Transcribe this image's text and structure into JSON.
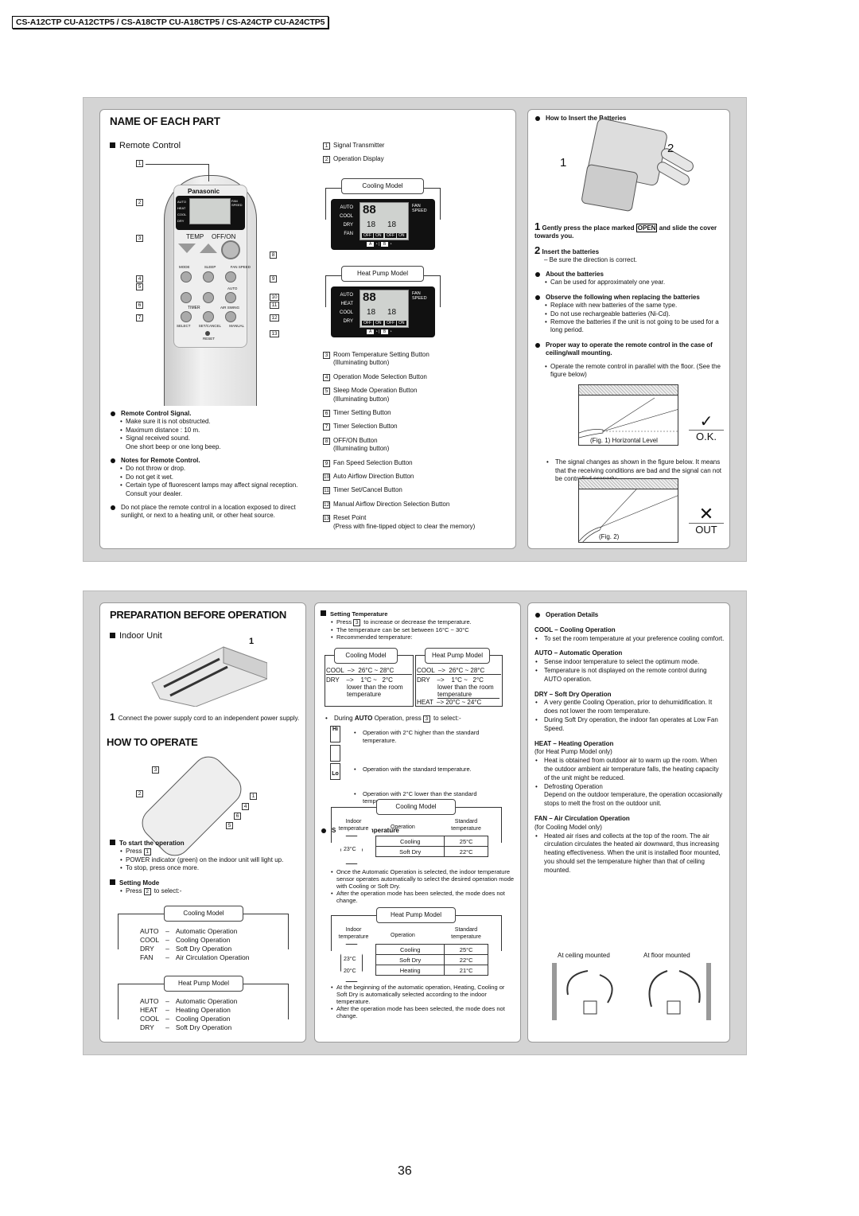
{
  "header": {
    "models": "CS-A12CTP CU-A12CTP5 / CS-A18CTP CU-A18CTP5 / CS-A24CTP CU-A24CTP5"
  },
  "name_of_each_part": {
    "title": "NAME OF EACH PART",
    "remote_heading": "Remote Control",
    "remote": {
      "brand": "Panasonic",
      "modes": [
        "AUTO",
        "HEAT",
        "COOL",
        "DRY"
      ],
      "fan_speed": "FAN SPEED",
      "temp": "TEMP",
      "offon": "OFF/ON",
      "mode": "MODE",
      "sleep": "SLEEP",
      "fanspeed": "FAN SPEED",
      "auto": "AUTO",
      "timer": "TIMER",
      "air_swing": "AIR SWING",
      "select": "SELECT",
      "setcancel": "SET/CANCEL",
      "manual": "MANUAL",
      "reset": "RESET",
      "callouts": [
        "1",
        "2",
        "3",
        "4",
        "5",
        "6",
        "7",
        "8",
        "9",
        "10",
        "11",
        "12",
        "13"
      ]
    },
    "parts": [
      {
        "n": "1",
        "label": "Signal Transmitter"
      },
      {
        "n": "2",
        "label": "Operation Display"
      },
      {
        "n": "3",
        "label": "Room Temperature Setting Button",
        "sub": "(Illuminating button)"
      },
      {
        "n": "4",
        "label": "Operation Mode Selection Button"
      },
      {
        "n": "5",
        "label": "Sleep Mode Operation Button",
        "sub": "(Illuminating button)"
      },
      {
        "n": "6",
        "label": "Timer Setting Button"
      },
      {
        "n": "7",
        "label": "Timer Selection Button"
      },
      {
        "n": "8",
        "label": "OFF/ON Button",
        "sub": "(Illuminating button)"
      },
      {
        "n": "9",
        "label": "Fan Speed Selection Button"
      },
      {
        "n": "10",
        "label": "Auto Airflow Direction Button"
      },
      {
        "n": "11",
        "label": "Timer Set/Cancel Button"
      },
      {
        "n": "12",
        "label": "Manual Airflow Direction Selection Button"
      },
      {
        "n": "13",
        "label": "Reset Point",
        "sub": "(Press with fine-tipped object to clear the memory)"
      }
    ],
    "displays": [
      {
        "title": "Cooling Model",
        "modes": [
          "AUTO",
          "COOL",
          "DRY",
          "FAN"
        ],
        "digits": "88",
        "timer": "18",
        "fan": "FAN SPEED",
        "off": "OFF",
        "on": "ON",
        "a": "A",
        "b": "B"
      },
      {
        "title": "Heat Pump Model",
        "modes": [
          "AUTO",
          "HEAT",
          "COOL",
          "DRY"
        ],
        "digits": "88",
        "timer": "18",
        "fan": "FAN SPEED",
        "off": "OFF",
        "on": "ON",
        "a": "A",
        "b": "B"
      }
    ],
    "signal": {
      "title": "Remote Control Signal.",
      "items": [
        "Make sure it is not obstructed.",
        "Maximum distance : 10 m.",
        "Signal received sound."
      ],
      "extra": "One short beep or one long beep."
    },
    "notes": {
      "title": "Notes for Remote Control.",
      "items": [
        "Do not throw or drop.",
        "Do not get it wet.",
        "Certain type of fluorescent lamps may affect signal reception. Consult your dealer."
      ]
    },
    "placement": "Do not place the remote control in a location exposed to direct sunlight, or next to a heating unit, or other heat  source."
  },
  "batteries": {
    "title": "How  to Insert the Batteries",
    "fig_labels": [
      "1",
      "2"
    ],
    "step1_num": "1",
    "step1_a": "Gently press the place marked",
    "step1_open": "OPEN",
    "step1_b": "and slide the cover towards you.",
    "step2_num": "2",
    "step2": "Insert the batteries",
    "step2_sub": "– Be sure the direction is correct.",
    "about": {
      "title": "About the batteries",
      "items": [
        "Can be used for approximately one year."
      ]
    },
    "observe": {
      "title": "Observe the following when replacing the batteries",
      "items": [
        "Replace with new batteries of the same type.",
        "Do not use rechargeable batteries (Ni-Cd).",
        "Remove the batteries if the unit is not going to be used for a long period."
      ]
    },
    "proper": {
      "title": "Proper way to operate the remote control in the case of ceiling/wall mounting.",
      "items": [
        "Operate the remote control in parallel with the floor. (See the figure below)"
      ]
    },
    "fig1": "(Fig. 1) Horizontal Level",
    "ok": "O.K.",
    "signal_note": "The signal changes as shown in the figure below. It means that the receiving conditions are bad and the signal can not be controlled properly.",
    "fig2": "(Fig. 2)",
    "out": "OUT"
  },
  "preparation": {
    "title": "PREPARATION BEFORE OPERATION",
    "indoor": "Indoor Unit",
    "callout": "1",
    "step_num": "1",
    "step": "Connect the power supply cord to an independent power supply."
  },
  "how_to_operate": {
    "title": "HOW TO OPERATE",
    "callouts": [
      "3",
      "2",
      "1",
      "4",
      "6",
      "5"
    ],
    "start": {
      "title": "To start the operation",
      "press": "Press",
      "key": "1",
      "items": [
        "POWER indicator (green) on the indoor unit will light up.",
        "To stop, press once more."
      ]
    },
    "mode": {
      "title": "Setting Mode",
      "press": "Press",
      "key": "2",
      "to_select": "to select:-",
      "cooling": {
        "title": "Cooling Model",
        "rows": [
          [
            "AUTO",
            "–",
            "Automatic Operation"
          ],
          [
            "COOL",
            "–",
            "Cooling Operation"
          ],
          [
            "DRY",
            "–",
            "Soft Dry Operation"
          ],
          [
            "FAN",
            "–",
            "Air Circulation Operation"
          ]
        ]
      },
      "heatpump": {
        "title": "Heat Pump Model",
        "rows": [
          [
            "AUTO",
            "–",
            "Automatic Operation"
          ],
          [
            "HEAT",
            "–",
            "Heating Operation"
          ],
          [
            "COOL",
            "–",
            "Cooling Operation"
          ],
          [
            "DRY",
            "–",
            "Soft Dry Operation"
          ]
        ]
      }
    }
  },
  "setting_temp": {
    "title": "Setting Temperature",
    "b1a": "Press",
    "key": "3",
    "b1b": "to increase or decrease the temperature.",
    "b2": "The temperature can be set between 16°C ~ 30°C",
    "b3": "Recommended temperature:",
    "cooling": {
      "title": "Cooling Model",
      "cool": "COOL  –>  26°C ~ 28°C",
      "dry": "DRY    –>    1°C ~   2°C",
      "dry_note": "lower than the room temperature"
    },
    "heatpump": {
      "title": "Heat Pump Model",
      "cool": "COOL  –>  26°C ~ 28°C",
      "dry": "DRY    –>    1°C ~   2°C",
      "dry_note": "lower than the room temperature",
      "heat": "HEAT  –> 20°C ~ 24°C"
    },
    "auto_a": "During",
    "auto_b": "AUTO",
    "auto_c": "Operation, press",
    "auto_d": "to select:-",
    "icon_hi": "Hi",
    "icon_lo": "Lo",
    "options": [
      "Operation with 2°C higher than the standard temperature.",
      "Operation with the standard temperature.",
      "Operation with 2°C lower than the standard temperature."
    ]
  },
  "standard_temp": {
    "title": "Standard Temperature",
    "cooling": {
      "title": "Cooling Model",
      "indoor": "Indoor temperature",
      "operation": "Operation",
      "standard": "Standard temperature",
      "thresholds": [
        "23°C"
      ],
      "rows": [
        [
          "Cooling",
          "25°C"
        ],
        [
          "Soft Dry",
          "22°C"
        ]
      ]
    },
    "notes1": [
      "Once the Automatic Operation is selected, the indoor temperature sensor operates automatically to select the desired operation mode with Cooling or Soft Dry.",
      "After the operation mode has been selected, the mode does not change."
    ],
    "heatpump": {
      "title": "Heat Pump Model",
      "indoor": "Indoor temperature",
      "operation": "Operation",
      "standard": "Standard temperature",
      "thresholds": [
        "23°C",
        "20°C"
      ],
      "rows": [
        [
          "Cooling",
          "25°C"
        ],
        [
          "Soft Dry",
          "22°C"
        ],
        [
          "Heating",
          "21°C"
        ]
      ]
    },
    "notes2": [
      "At the beginning of the automatic operation, Heating, Cooling or Soft Dry is automatically selected according to the indoor temperature.",
      "After the operation mode has been selected, the mode does not change."
    ]
  },
  "operation_details": {
    "title": "Operation Details",
    "sections": [
      {
        "head": "COOL – Cooling Operation",
        "items": [
          "To set the room temperature at your preference cooling comfort."
        ]
      },
      {
        "head": "AUTO – Automatic Operation",
        "items": [
          "Sense indoor temperature to select the optimum mode.",
          "Temperature is not displayed on the remote control during AUTO operation."
        ]
      },
      {
        "head": "DRY – Soft Dry Operation",
        "items": [
          "A very gentle Cooling Operation, prior to dehumidification. It does not lower the room temperature.",
          "During Soft Dry operation, the indoor fan operates at Low Fan Speed."
        ]
      },
      {
        "head": "HEAT – Heating Operation",
        "note": "(for Heat Pump Model only)",
        "items": [
          "Heat is obtained from outdoor air to warm up the room. When the outdoor ambient air temperature falls, the heating capacity of the unit might be reduced.",
          "Defrosting Operation"
        ],
        "extra": "Depend on the outdoor temperature, the operation occasionally stops to melt the frost on the outdoor unit."
      },
      {
        "head": "FAN – Air Circulation Operation",
        "note": "(for Cooling Model only)",
        "items": [
          "Heated air rises and collects at the top of the room. The air circulation circulates the heated air downward, thus increasing heating effectiveness. When the unit is installed floor mounted, you should set the temperature higher than that of ceiling mounted."
        ]
      }
    ],
    "ceiling": "At ceiling mounted",
    "floor": "At floor mounted"
  },
  "page_number": "36"
}
